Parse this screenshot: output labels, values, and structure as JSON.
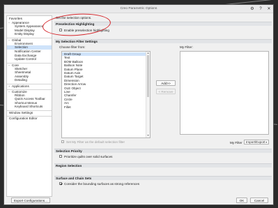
{
  "window": {
    "title": "Creo Parametric Options"
  },
  "sidebar": {
    "items": [
      {
        "label": "Favorites",
        "level": 0,
        "section": true
      },
      {
        "label": "Appearance",
        "level": 0,
        "twisty": "−"
      },
      {
        "label": "System Appearance",
        "level": 1
      },
      {
        "label": "Model Display",
        "level": 1
      },
      {
        "label": "Entity Display",
        "level": 1
      },
      {
        "label": "Global",
        "level": 0,
        "twisty": "−",
        "section": true
      },
      {
        "label": "Environment",
        "level": 1
      },
      {
        "label": "Selection",
        "level": 1,
        "selected": true
      },
      {
        "label": "Notification Center",
        "level": 1
      },
      {
        "label": "Data Exchange",
        "level": 1
      },
      {
        "label": "Update Control",
        "level": 1
      },
      {
        "label": "Core",
        "level": 0,
        "twisty": "−",
        "section": true
      },
      {
        "label": "Sketcher",
        "level": 1
      },
      {
        "label": "Sheetmetal",
        "level": 1
      },
      {
        "label": "Assembly",
        "level": 1
      },
      {
        "label": "Detailing",
        "level": 1
      },
      {
        "label": "Applications",
        "level": 0,
        "twisty": "+",
        "section": true
      },
      {
        "label": "Customize",
        "level": 0,
        "twisty": "−",
        "section": true
      },
      {
        "label": "Ribbon",
        "level": 1
      },
      {
        "label": "Quick Access Toolbar",
        "level": 1
      },
      {
        "label": "Shortcut Menus",
        "level": 1
      },
      {
        "label": "Keyboard Shortcuts",
        "level": 1
      },
      {
        "label": "Window Settings",
        "level": 0,
        "section": true
      },
      {
        "label": "Configuration Editor",
        "level": 0,
        "section": true
      }
    ]
  },
  "main": {
    "intro": "Set the selection options.",
    "preselection": {
      "header": "Preselection Highlighting",
      "checkbox_label": "Enable preselection highlighting",
      "checked": false
    },
    "filter": {
      "header": "My Selection Filter Settings",
      "choose_label": "Choose filter from:",
      "my_filter_label": "My Filter:",
      "items": [
        "Draft Group",
        "Text",
        "BOM Balloon",
        "Balloon Note",
        "Datum Plane",
        "Datum Axis",
        "Datum Target",
        "Dimension",
        "Direction Arrow",
        "OLE Object",
        "Line",
        "Chamfer",
        "Circle",
        "Arc",
        "Fillet"
      ],
      "add_button": "Add>>",
      "remove_button": "< Remove",
      "default_checkbox_label": "Set My Filter as the default selection filter",
      "default_checked": false,
      "my_filter_dropdown_label": "My Filter",
      "import_export": "Import/Export"
    },
    "priority": {
      "header": "Selection Priority",
      "checkbox_label": "Prioritize quilts over solid surfaces",
      "checked": false
    },
    "region": {
      "header": "Region Selection"
    },
    "chain": {
      "header": "Surface and Chain Sets",
      "checkbox_label": "Consider the bounding surfaces as strong references",
      "checked": true
    }
  },
  "footer": {
    "export_button": "Export Configurations...",
    "ok_button": "OK",
    "cancel_button": "Cancel"
  },
  "colors": {
    "selection": "#cfe3fa",
    "annotation_circle": "#d5252a"
  }
}
